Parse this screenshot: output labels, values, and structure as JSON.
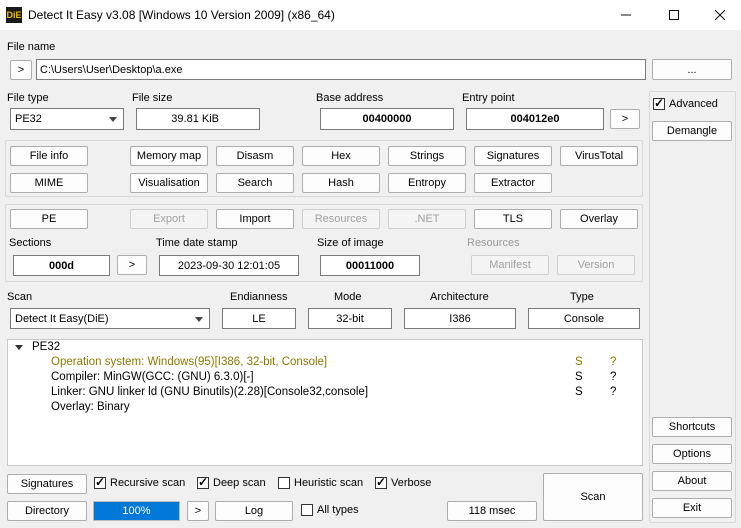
{
  "window": {
    "title": "Detect It Easy v3.08 [Windows 10 Version 2009] (x86_64)",
    "icon_text": "DiE"
  },
  "file": {
    "label": "File name",
    "path": "C:\\Users\\User\\Desktop\\a.exe",
    "browse_label": "...",
    "go_label": ">"
  },
  "info": {
    "file_type_label": "File type",
    "file_type": "PE32",
    "file_size_label": "File size",
    "file_size": "39.81 KiB",
    "base_address_label": "Base address",
    "base_address": "00400000",
    "entry_point_label": "Entry point",
    "entry_point": "004012e0",
    "entry_go": ">"
  },
  "side": {
    "advanced_label": "Advanced",
    "advanced_checked": true,
    "demangle": "Demangle",
    "shortcuts": "Shortcuts",
    "options": "Options",
    "about": "About",
    "exit": "Exit"
  },
  "tools": {
    "row1": [
      "File info",
      "Memory map",
      "Disasm",
      "Hex",
      "Strings",
      "Signatures",
      "VirusTotal"
    ],
    "row2": [
      "MIME",
      "Visualisation",
      "Search",
      "Hash",
      "Entropy",
      "Extractor"
    ]
  },
  "pe": {
    "buttons": [
      "PE",
      "Export",
      "Import",
      "Resources",
      ".NET",
      "TLS",
      "Overlay"
    ],
    "sections_label": "Sections",
    "sections": "000d",
    "sections_go": ">",
    "timestamp_label": "Time date stamp",
    "timestamp": "2023-09-30 12:01:05",
    "size_label": "Size of image",
    "size": "00011000",
    "resources_label": "Resources",
    "manifest": "Manifest",
    "version": "Version"
  },
  "scan": {
    "label": "Scan",
    "engine": "Detect It Easy(DiE)",
    "endianness_label": "Endianness",
    "endianness": "LE",
    "mode_label": "Mode",
    "mode": "32-bit",
    "arch_label": "Architecture",
    "arch": "I386",
    "type_label": "Type",
    "type": "Console"
  },
  "results": {
    "root": "PE32",
    "items": [
      {
        "text": "Operation system: Windows(95)[I386, 32-bit, Console]",
        "flag1": "S",
        "flag2": "?",
        "highlight": true
      },
      {
        "text": "Compiler: MinGW(GCC: (GNU) 6.3.0)[-]",
        "flag1": "S",
        "flag2": "?",
        "highlight": false
      },
      {
        "text": "Linker: GNU linker ld (GNU Binutils)(2.28)[Console32,console]",
        "flag1": "S",
        "flag2": "?",
        "highlight": false
      },
      {
        "text": "Overlay: Binary",
        "flag1": "",
        "flag2": "",
        "highlight": false
      }
    ],
    "highlight_color": "#8a7a00"
  },
  "bottom": {
    "signatures": "Signatures",
    "recursive": "Recursive scan",
    "deep": "Deep scan",
    "heuristic": "Heuristic scan",
    "verbose": "Verbose",
    "scan": "Scan",
    "directory": "Directory",
    "progress_text": "100%",
    "progress_value": 1.0,
    "go": ">",
    "log": "Log",
    "all_types": "All types",
    "time": "118 msec",
    "recursive_checked": true,
    "deep_checked": true,
    "heuristic_checked": false,
    "verbose_checked": true,
    "all_types_checked": false
  }
}
